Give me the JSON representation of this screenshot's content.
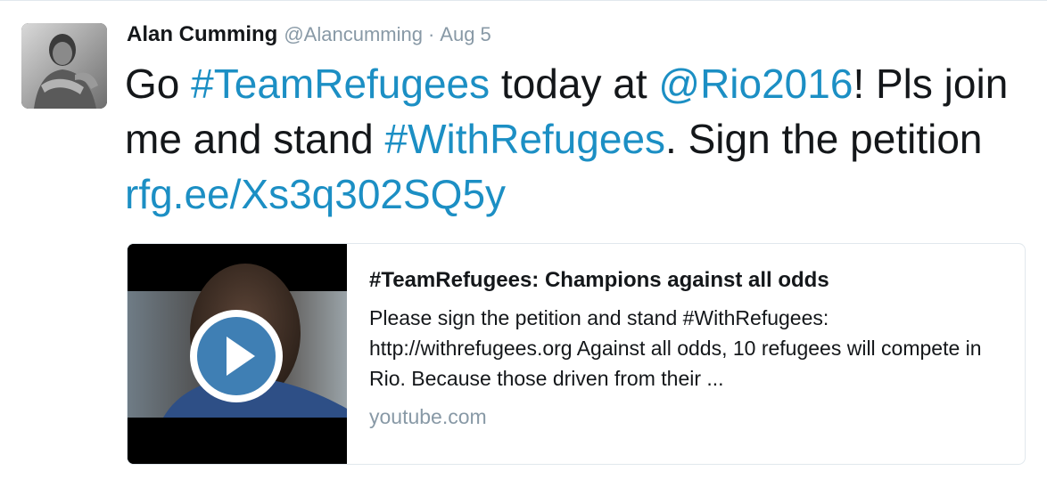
{
  "author": {
    "name": "Alan Cumming",
    "handle": "@Alancumming",
    "separator": "·",
    "timestamp": "Aug 5",
    "avatar_icon": "user-avatar"
  },
  "tweet": {
    "segments": [
      {
        "text": "Go ",
        "type": "plain"
      },
      {
        "text": "#TeamRefugees",
        "type": "hashtag"
      },
      {
        "text": " today at ",
        "type": "plain"
      },
      {
        "text": "@Rio2016",
        "type": "mention"
      },
      {
        "text": "! Pls join me and stand ",
        "type": "plain"
      },
      {
        "text": "#WithRefugees",
        "type": "hashtag"
      },
      {
        "text": ". Sign the petition ",
        "type": "plain"
      },
      {
        "text": "rfg.ee/Xs3q302SQ5y",
        "type": "url"
      }
    ]
  },
  "card": {
    "title": "#TeamRefugees: Champions against all odds",
    "description": "Please sign the petition and stand #WithRefugees: http://withrefugees.org Against all odds, 10 refugees will compete in Rio. Because those driven from their ...",
    "domain": "youtube.com",
    "thumbnail_icon": "video-thumbnail",
    "play_icon": "play-icon"
  },
  "colors": {
    "link": "#1c8fc4",
    "text": "#14171a",
    "muted": "#8899a6",
    "border": "#e1e8ed",
    "play_fill": "#3f7fb4"
  }
}
